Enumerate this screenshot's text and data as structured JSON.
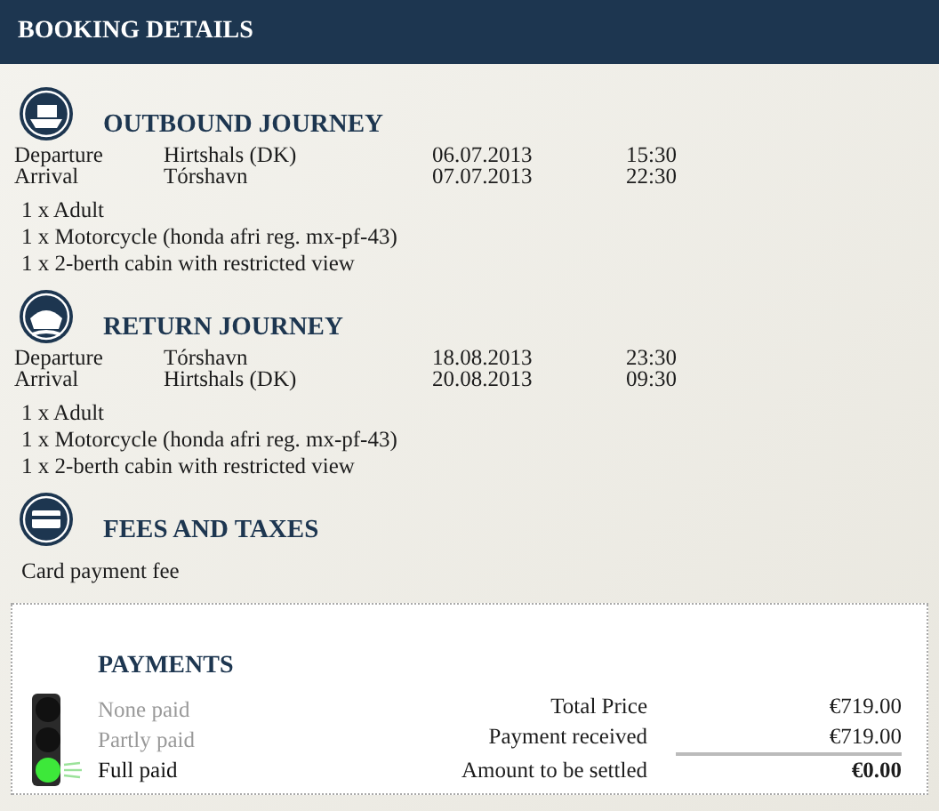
{
  "header": {
    "title": "BOOKING DETAILS"
  },
  "sections": [
    {
      "kind": "outbound",
      "title": "OUTBOUND JOURNEY",
      "legs": [
        {
          "label": "Departure",
          "place": "Hirtshals (DK)",
          "date": "06.07.2013",
          "time": "15:30"
        },
        {
          "label": "Arrival",
          "place": "Tórshavn",
          "date": "07.07.2013",
          "time": "22:30"
        }
      ],
      "items": [
        "1 x Adult",
        "1 x Motorcycle (honda afri reg. mx-pf-43)",
        "1 x 2-berth cabin with restricted view"
      ]
    },
    {
      "kind": "return",
      "title": "RETURN JOURNEY",
      "legs": [
        {
          "label": "Departure",
          "place": "Tórshavn",
          "date": "18.08.2013",
          "time": "23:30"
        },
        {
          "label": "Arrival",
          "place": "Hirtshals (DK)",
          "date": "20.08.2013",
          "time": "09:30"
        }
      ],
      "items": [
        "1 x Adult",
        "1 x Motorcycle (honda afri reg. mx-pf-43)",
        "1 x 2-berth cabin with restricted view"
      ]
    },
    {
      "kind": "fees",
      "title": "FEES AND TAXES",
      "items": [
        "Card payment fee"
      ]
    }
  ],
  "payments": {
    "title": "PAYMENTS",
    "statuses": [
      {
        "label": "None paid",
        "selected": false
      },
      {
        "label": "Partly paid",
        "selected": false
      },
      {
        "label": "Full paid",
        "selected": true
      }
    ],
    "totals": [
      {
        "label": "Total Price",
        "value": "€719.00"
      },
      {
        "label": "Payment received",
        "value": "€719.00"
      },
      {
        "label": "Amount to be settled",
        "value": "€0.00"
      }
    ]
  }
}
